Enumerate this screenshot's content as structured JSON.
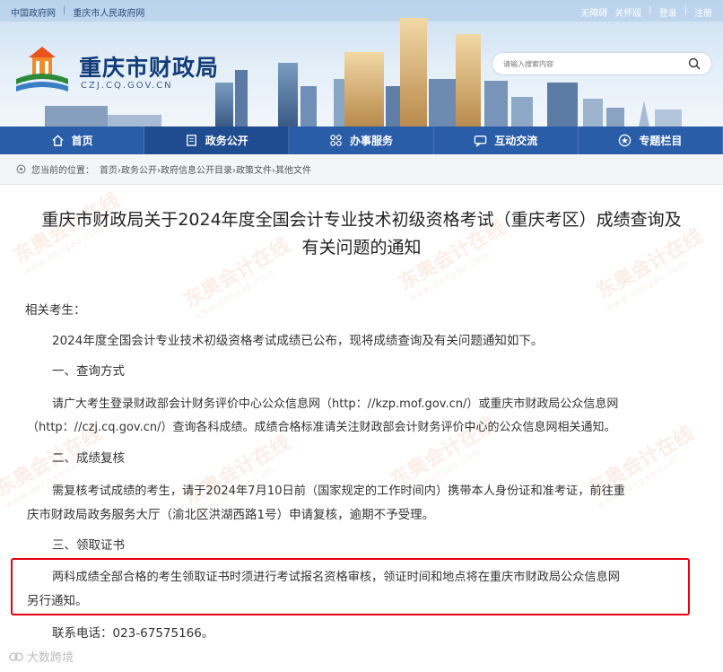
{
  "topbar": {
    "left_links": [
      "中国政府网",
      "重庆市人民政府网"
    ],
    "right_links": [
      "无障碍",
      "关怀版",
      "登录",
      "注册"
    ]
  },
  "site": {
    "name": "重庆市财政局",
    "domain": "CZJ.CQ.GOV.CN"
  },
  "search": {
    "placeholder": "请输入搜索内容",
    "icon": "search-icon"
  },
  "nav": {
    "items": [
      {
        "label": "首页",
        "icon": "home-icon"
      },
      {
        "label": "政务公开",
        "icon": "document-icon"
      },
      {
        "label": "办事服务",
        "icon": "grid-icon"
      },
      {
        "label": "互动交流",
        "icon": "chat-icon"
      },
      {
        "label": "专题栏目",
        "icon": "star-icon"
      }
    ],
    "active_index": 1,
    "color": "#2a5da8"
  },
  "breadcrumb": {
    "prefix": "您当前的位置：",
    "path": "首页›政务公开›政府信息公开目录›政策文件›其他文件"
  },
  "article": {
    "title_line1": "重庆市财政局关于2024年度全国会计专业技术初级资格考试（重庆考区）成绩查询及",
    "title_line2": "有关问题的通知",
    "salutation": "相关考生：",
    "intro": "2024年度全国会计专业技术初级资格考试成绩已公布，现将成绩查询及有关问题通知如下。",
    "section1_heading": "一、查询方式",
    "section1_line1": "请广大考生登录财政部会计财务评价中心公众信息网（http：//kzp.mof.gov.cn/）或重庆市财政局公众信息网",
    "section1_line2": "（http：//czj.cq.gov.cn/）查询各科成绩。成绩合格标准请关注财政部会计财务评价中心的公众信息网相关通知。",
    "section2_heading": "二、成绩复核",
    "section2_line1": "需复核考试成绩的考生，请于2024年7月10日前（国家规定的工作时间内）携带本人身份证和准考证，前往重",
    "section2_line2": "庆市财政局政务服务大厅（渝北区洪湖西路1号）申请复核，逾期不予受理。",
    "section3_heading": "三、领取证书",
    "section3_line1": "两科成绩全部合格的考生领取证书时须进行考试报名资格审核，领证时间和地点将在重庆市财政局公众信息网",
    "section3_line2": "另行通知。",
    "contact": "联系电话：023-67575166。"
  },
  "watermark": {
    "text": "东奥会计在线",
    "sub": "www.dongao.com"
  },
  "bottom_mark": "大数跨境",
  "highlight_color": "#e60012"
}
